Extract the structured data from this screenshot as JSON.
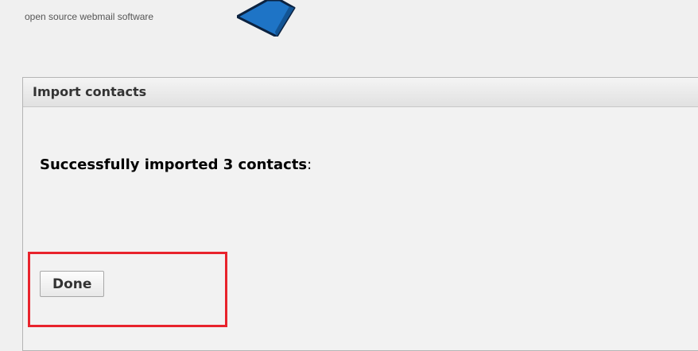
{
  "header": {
    "tagline": "open source webmail software",
    "logo_icon": "blue-cube-logo"
  },
  "panel": {
    "title": "Import contacts",
    "message_bold": "Successfully imported 3 contacts",
    "message_suffix": ":",
    "done_label": "Done"
  },
  "annotation": {
    "color": "#e8232c"
  },
  "colors": {
    "background": "#f0f0f0",
    "logo_blue": "#1e74c6"
  }
}
